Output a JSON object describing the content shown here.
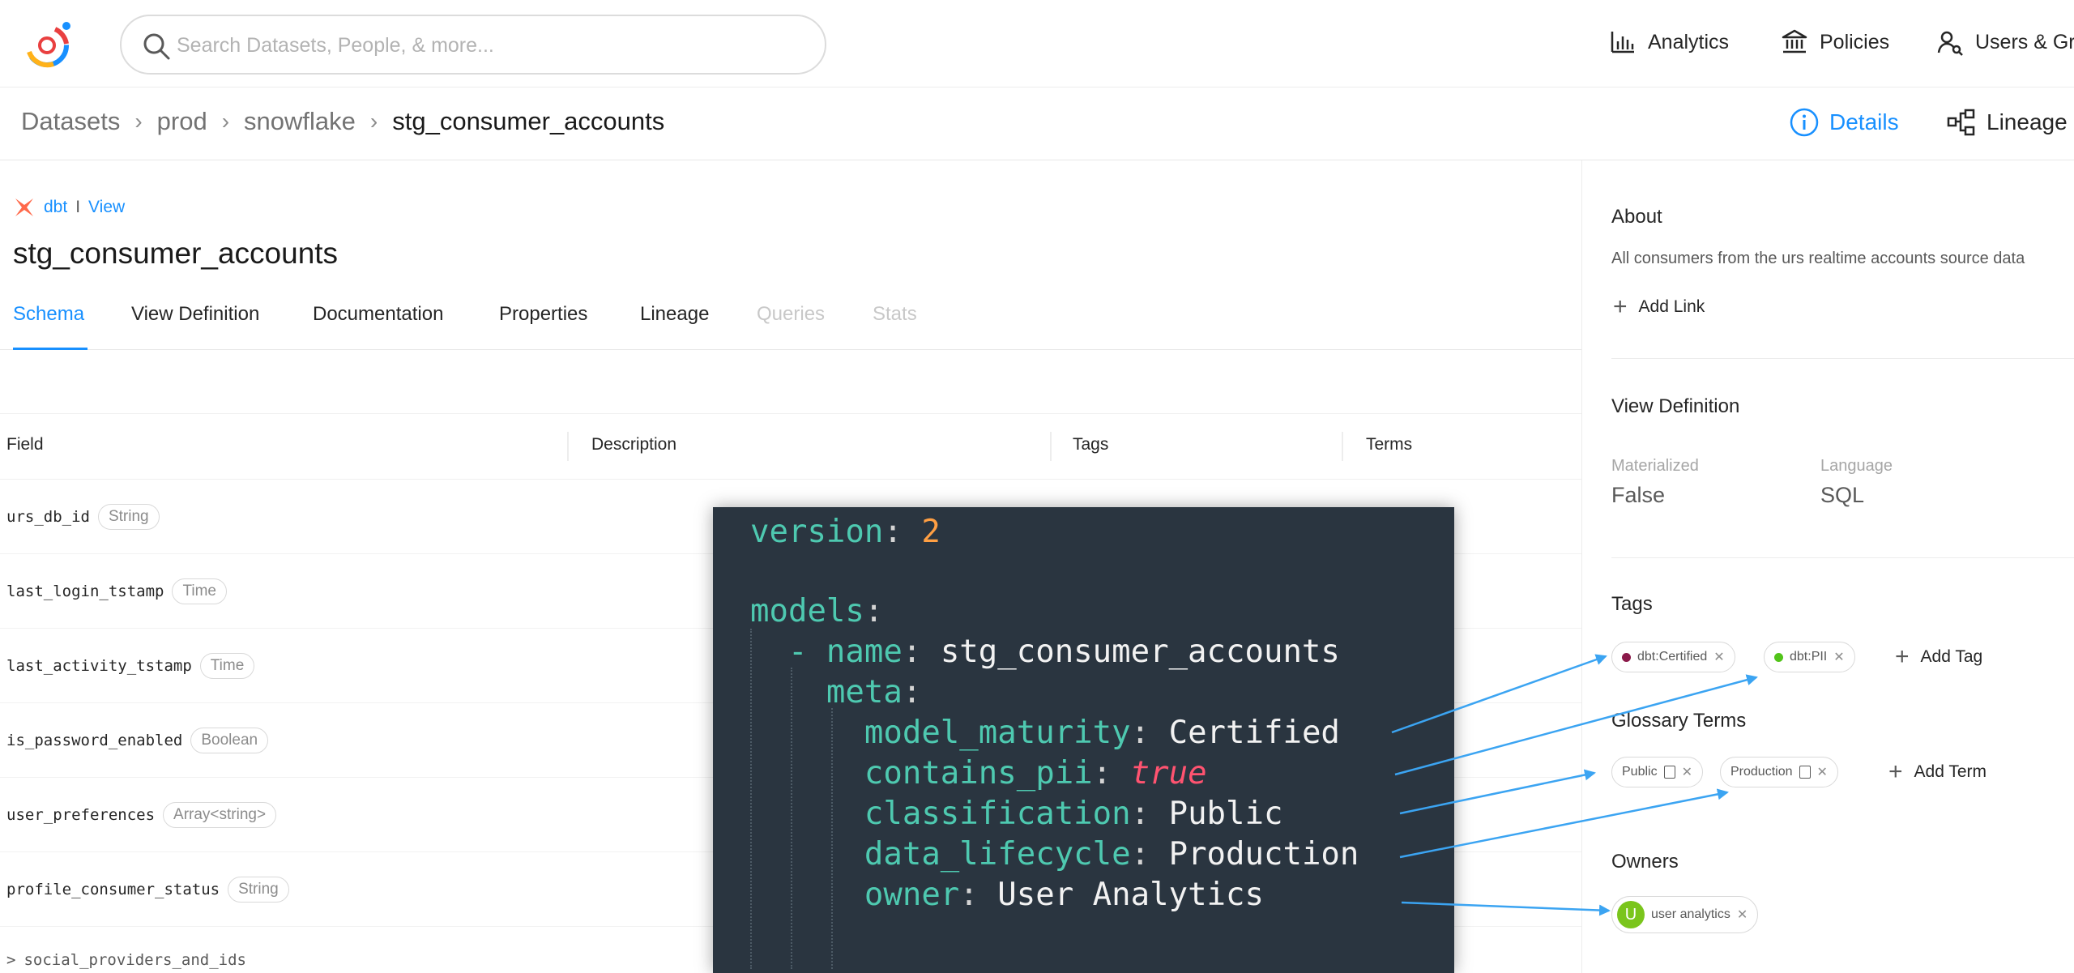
{
  "header": {
    "search_placeholder": "Search Datasets, People, & more...",
    "nav": [
      {
        "label": "Analytics",
        "icon": "bar-chart-icon"
      },
      {
        "label": "Policies",
        "icon": "bank-icon"
      },
      {
        "label": "Users & Gro",
        "icon": "users-icon"
      }
    ]
  },
  "breadcrumb": {
    "items": [
      "Datasets",
      "prod",
      "snowflake"
    ],
    "current": "stg_consumer_accounts",
    "sep": "›"
  },
  "view_tabs": {
    "details": "Details",
    "lineage": "Lineage"
  },
  "entity": {
    "platform": "dbt",
    "separator": "I",
    "type": "View",
    "title": "stg_consumer_accounts",
    "tabs": [
      "Schema",
      "View Definition",
      "Documentation",
      "Properties",
      "Lineage",
      "Queries",
      "Stats"
    ],
    "active_tab": "Schema"
  },
  "schema": {
    "columns": [
      "Field",
      "Description",
      "Tags",
      "Terms"
    ],
    "rows": [
      {
        "field": "urs_db_id",
        "type": "String"
      },
      {
        "field": "last_login_tstamp",
        "type": "Time"
      },
      {
        "field": "last_activity_tstamp",
        "type": "Time"
      },
      {
        "field": "is_password_enabled",
        "type": "Boolean"
      },
      {
        "field": "user_preferences",
        "type": "Array<string>"
      },
      {
        "field": "profile_consumer_status",
        "type": "String"
      },
      {
        "field": "social_providers_and_ids",
        "expand": ">"
      }
    ]
  },
  "sidebar": {
    "about": {
      "heading": "About",
      "text": "All consumers from the urs realtime accounts source data",
      "add_link": "Add Link"
    },
    "view_definition": {
      "heading": "View Definition",
      "materialized_label": "Materialized",
      "materialized_value": "False",
      "language_label": "Language",
      "language_value": "SQL"
    },
    "tags": {
      "heading": "Tags",
      "items": [
        {
          "label": "dbt:Certified",
          "color": "#8b1a4a"
        },
        {
          "label": "dbt:PII",
          "color": "#52c41a"
        }
      ],
      "add": "Add Tag"
    },
    "glossary": {
      "heading": "Glossary Terms",
      "items": [
        "Public",
        "Production"
      ],
      "add": "Add Term"
    },
    "owners": {
      "heading": "Owners",
      "items": [
        {
          "initial": "U",
          "label": "user analytics"
        }
      ]
    }
  },
  "code_overlay": {
    "version_key": "version",
    "version_value": "2",
    "models_key": "models",
    "name_key": "name",
    "name_value": "stg_consumer_accounts",
    "meta_key": "meta",
    "entries": [
      {
        "key": "model_maturity",
        "value": "Certified"
      },
      {
        "key": "contains_pii",
        "value": "true"
      },
      {
        "key": "classification",
        "value": "Public"
      },
      {
        "key": "data_lifecycle",
        "value": "Production"
      },
      {
        "key": "owner",
        "value": "User Analytics"
      }
    ]
  },
  "colors": {
    "accent": "#1890ff",
    "code_bg": "#2a3540",
    "arrow": "#3ba4f2"
  }
}
